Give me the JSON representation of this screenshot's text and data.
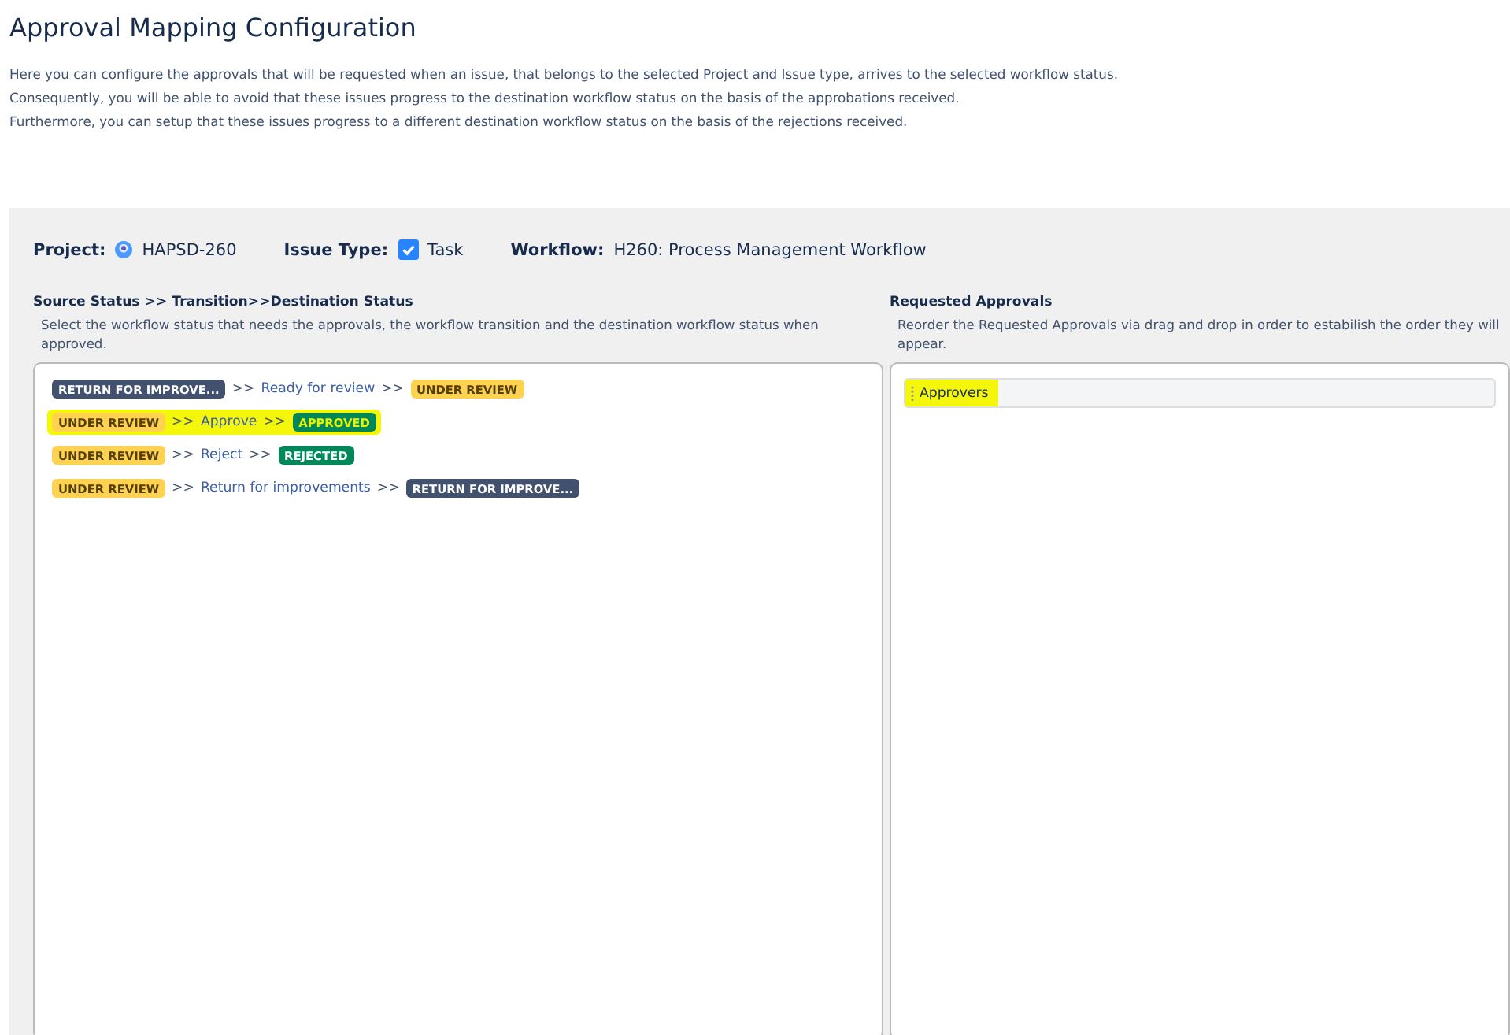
{
  "title": "Approval Mapping Configuration",
  "description": [
    "Here you can configure the approvals that will be requested when an issue, that belongs to the selected Project and Issue type, arrives to the selected workflow status.",
    "Consequently, you will be able to avoid that these issues progress to the destination workflow status on the basis of the approbations received.",
    "Furthermore, you can setup that these issues progress to a different destination workflow status on the basis of the rejections received."
  ],
  "header": {
    "project_label": "Project:",
    "project": "HAPSD-260",
    "issue_type_label": "Issue Type:",
    "issue_type": "Task",
    "workflow_label": "Workflow:",
    "workflow": "H260: Process Management Workflow"
  },
  "mappings": {
    "heading": "Source Status >> Transition>>Destination Status",
    "hint": "Select the workflow status that needs the approvals, the workflow transition and the destination workflow status when approved.",
    "rows": [
      {
        "source": {
          "label": "RETURN FOR IMPROVE...",
          "color": "#42526e"
        },
        "sep1": ">>",
        "transition": "Ready for review",
        "sep2": ">>",
        "destination": {
          "label": "UNDER REVIEW",
          "color": "#ffd351"
        },
        "selected": false
      },
      {
        "source": {
          "label": "UNDER REVIEW",
          "color": "#ffd351"
        },
        "sep1": ">>",
        "transition": "Approve",
        "sep2": ">>",
        "destination": {
          "label": "APPROVED",
          "color": "#00875a"
        },
        "selected": true
      },
      {
        "source": {
          "label": "UNDER REVIEW",
          "color": "#ffd351"
        },
        "sep1": ">>",
        "transition": "Reject",
        "sep2": ">>",
        "destination": {
          "label": "REJECTED",
          "color": "#00875a"
        },
        "selected": false
      },
      {
        "source": {
          "label": "UNDER REVIEW",
          "color": "#ffd351"
        },
        "sep1": ">>",
        "transition": "Return for improvements",
        "sep2": ">>",
        "destination": {
          "label": "RETURN FOR IMPROVE...",
          "color": "#42526e"
        },
        "selected": false
      }
    ]
  },
  "approvals": {
    "heading": "Requested Approvals",
    "hint": "Reorder the Requested Approvals via drag and drop in order to estabilish the order they will appear.",
    "items": [
      {
        "label": "Approvers",
        "selected": true
      }
    ]
  }
}
